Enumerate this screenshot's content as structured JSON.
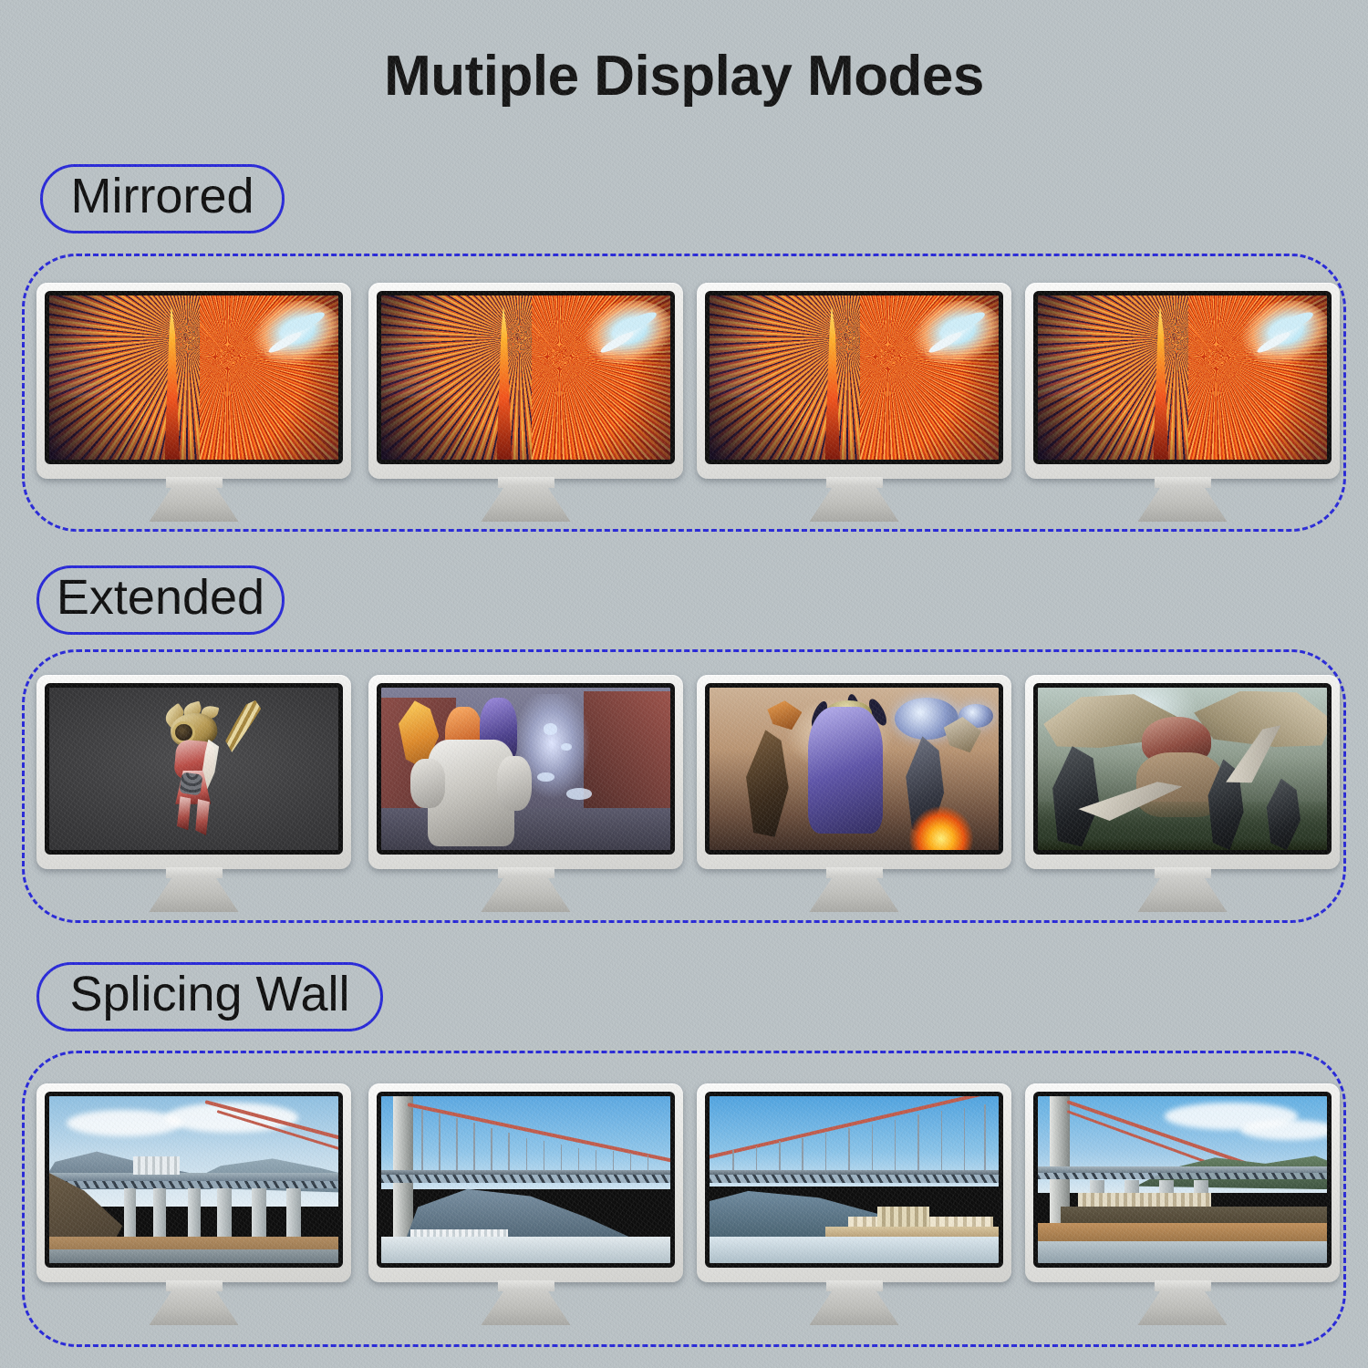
{
  "page": {
    "title": "Mutiple Display Modes",
    "background_color": "#b9c1c5",
    "accent_color": "#2626d8"
  },
  "sections": [
    {
      "id": "mirrored",
      "label": "Mirrored",
      "monitors": [
        {
          "name": "monitor-1",
          "content": "abstract-wave-wallpaper"
        },
        {
          "name": "monitor-2",
          "content": "abstract-wave-wallpaper"
        },
        {
          "name": "monitor-3",
          "content": "abstract-wave-wallpaper"
        },
        {
          "name": "monitor-4",
          "content": "abstract-wave-wallpaper"
        }
      ]
    },
    {
      "id": "extended",
      "label": "Extended",
      "monitors": [
        {
          "name": "monitor-1",
          "content": "game-warrior-character"
        },
        {
          "name": "monitor-2",
          "content": "game-hero-shooter-scene"
        },
        {
          "name": "monitor-3",
          "content": "game-sci-fi-combat-scene"
        },
        {
          "name": "monitor-4",
          "content": "game-monster-hunt-scene"
        }
      ]
    },
    {
      "id": "splicing-wall",
      "label": "Splicing Wall",
      "monitors": [
        {
          "name": "monitor-1",
          "content": "bridge-panorama-part-1"
        },
        {
          "name": "monitor-2",
          "content": "bridge-panorama-part-2"
        },
        {
          "name": "monitor-3",
          "content": "bridge-panorama-part-3"
        },
        {
          "name": "monitor-4",
          "content": "bridge-panorama-part-4"
        }
      ]
    }
  ]
}
